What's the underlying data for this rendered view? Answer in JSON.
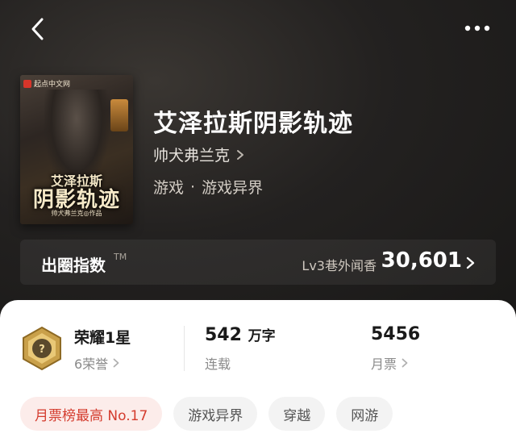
{
  "nav": {
    "back_icon": "chevron-left-icon",
    "more_icon": "more-dots-icon"
  },
  "cover": {
    "brand": "起点中文网",
    "title_line1": "艾泽拉斯",
    "title_line2": "阴影轨迹",
    "author_credit": "帅犬弗兰克◎作品"
  },
  "book": {
    "title": "艾泽拉斯阴影轨迹",
    "author": "帅犬弗兰克",
    "genre_main": "游戏",
    "genre_separator": "·",
    "genre_sub": "游戏异界"
  },
  "heat": {
    "label": "出圈指数",
    "trademark": "TM",
    "level": "Lv3巷外闻香",
    "value": "30,601"
  },
  "stats": {
    "honor_title": "荣耀1星",
    "honor_count": "6荣誉",
    "words_value": "542",
    "words_unit": "万字",
    "status": "连载",
    "tickets_value": "5456",
    "tickets_label": "月票"
  },
  "tags": [
    {
      "label": "月票榜最高 No.17",
      "highlight": true
    },
    {
      "label": "游戏异界",
      "highlight": false
    },
    {
      "label": "穿越",
      "highlight": false
    },
    {
      "label": "网游",
      "highlight": false
    }
  ],
  "colors": {
    "hero_bg": "#1b1a19",
    "highlight_tag_text": "#d43c2e",
    "highlight_tag_bg": "#fcecea",
    "badge_gold": "#c9a04a"
  }
}
